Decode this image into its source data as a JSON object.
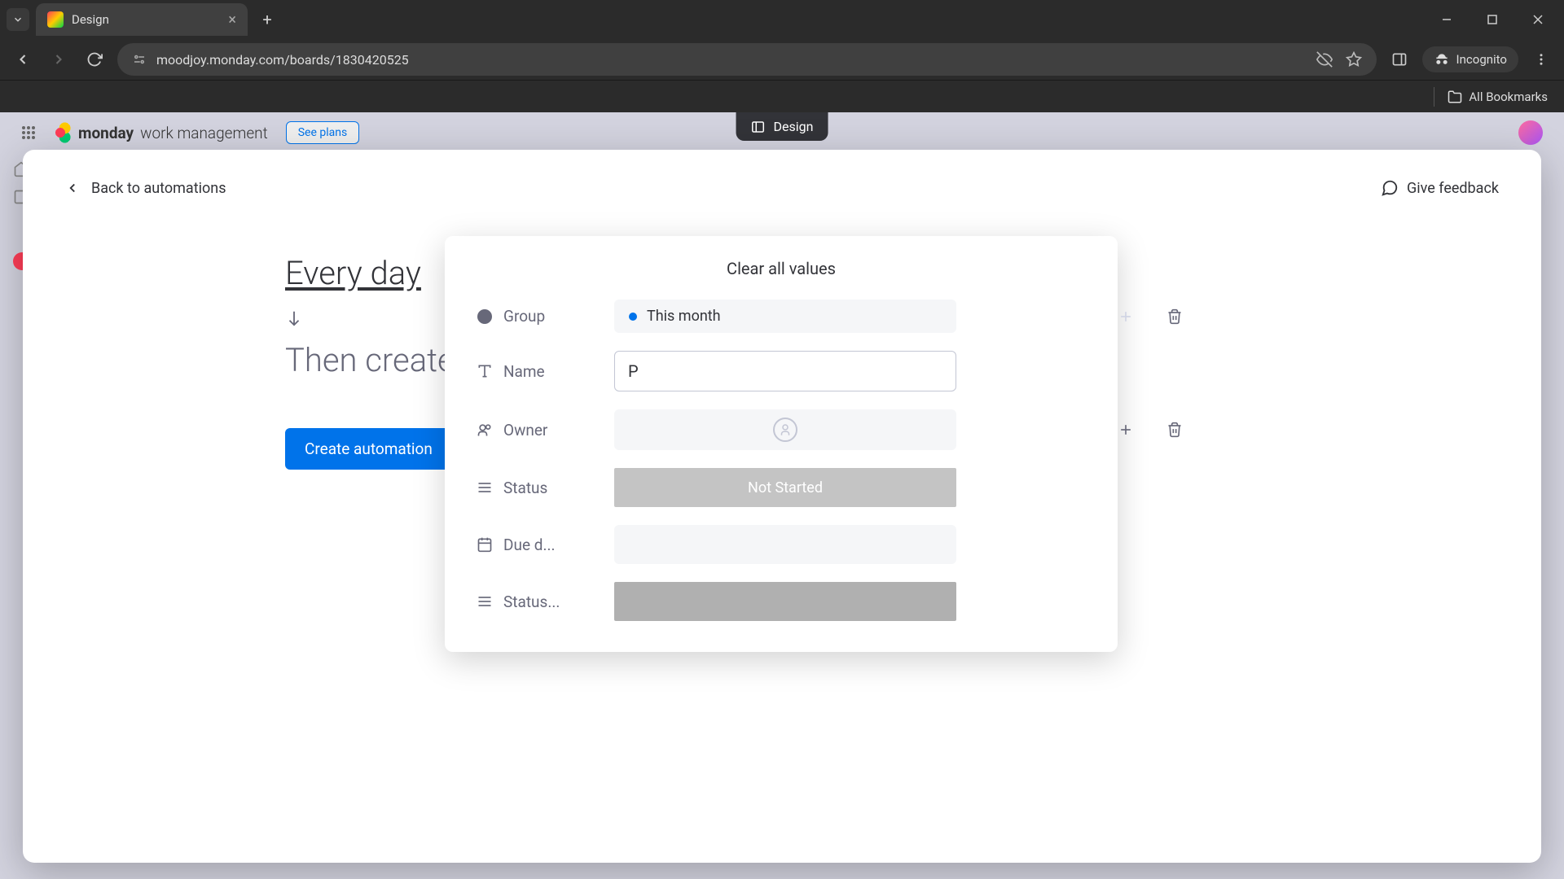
{
  "browser": {
    "tab_title": "Design",
    "url": "moodjoy.monday.com/boards/1830420525",
    "incognito_label": "Incognito",
    "all_bookmarks": "All Bookmarks"
  },
  "page_background": {
    "brand_bold": "monday",
    "brand_light": "work management",
    "see_plans": "See plans",
    "tab_indicator": "Design"
  },
  "modal": {
    "back_label": "Back to automations",
    "feedback_label": "Give feedback",
    "trigger_label": "Every day",
    "then_label": "Then create",
    "create_button": "Create automation"
  },
  "popup": {
    "clear_all": "Clear all values",
    "fields": {
      "group": {
        "label": "Group",
        "value": "This month"
      },
      "name": {
        "label": "Name",
        "value": "P"
      },
      "owner": {
        "label": "Owner"
      },
      "status": {
        "label": "Status",
        "value": "Not Started"
      },
      "due_date": {
        "label": "Due d..."
      },
      "status2": {
        "label": "Status..."
      }
    }
  }
}
